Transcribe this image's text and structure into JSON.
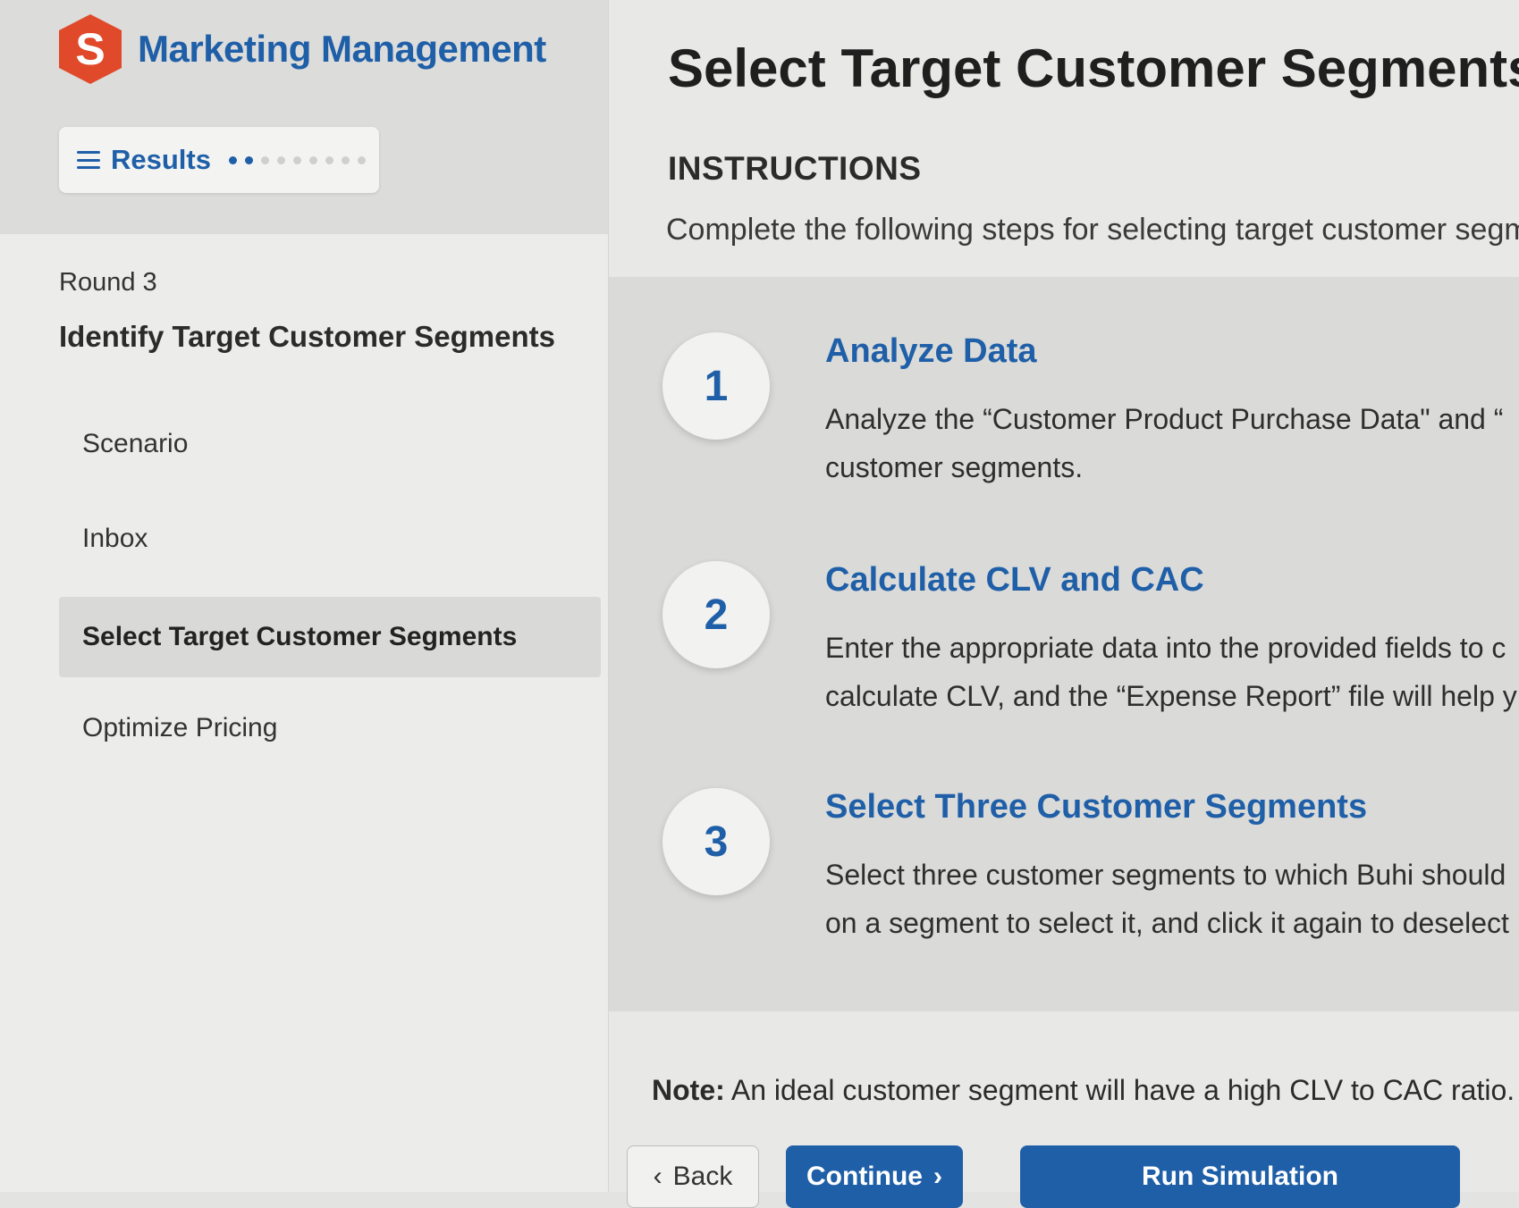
{
  "app": {
    "brand_letter": "S",
    "brand_name": "Marketing Management",
    "brand_color": "#1f5fa8",
    "logo_color": "#e04a2a"
  },
  "results_button": {
    "label": "Results",
    "icon": "hamburger-menu-icon",
    "progress_dots_total": 9,
    "progress_dots_completed": 2
  },
  "sidebar": {
    "round_label": "Round 3",
    "section_title": "Identify Target Customer Segments",
    "items": [
      {
        "label": "Scenario",
        "active": false
      },
      {
        "label": "Inbox",
        "active": false
      },
      {
        "label": "Select Target Customer Segments",
        "active": true
      },
      {
        "label": "Optimize Pricing",
        "active": false
      }
    ]
  },
  "main": {
    "title": "Select Target Customer Segments",
    "instructions_heading": "INSTRUCTIONS",
    "instructions_text": "Complete the following steps for selecting target customer segm",
    "steps": [
      {
        "number": "1",
        "title": "Analyze Data",
        "line1": "Analyze the “Customer Product Purchase Data\" and “",
        "line2": "customer segments."
      },
      {
        "number": "2",
        "title": "Calculate CLV and CAC",
        "line1": "Enter the appropriate data into the provided fields to c",
        "line2": "calculate CLV, and the “Expense Report” file will help y"
      },
      {
        "number": "3",
        "title": "Select Three Customer Segments",
        "line1": "Select three customer segments to which Buhi should",
        "line2": "on a segment to select it, and click it again to deselect"
      }
    ],
    "note_label": "Note:",
    "note_text": " An ideal customer segment will have a high CLV to CAC ratio."
  },
  "footer": {
    "back_label": "Back",
    "continue_label": "Continue",
    "run_label": "Run Simulation"
  }
}
